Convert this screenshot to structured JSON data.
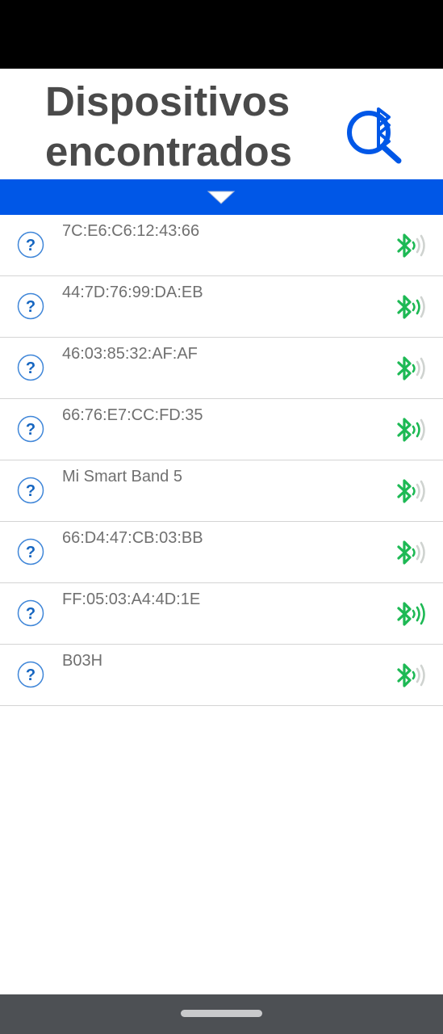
{
  "header": {
    "title": "Dispositivos\nencontrados",
    "scan_icon": "bluetooth-search-icon"
  },
  "collapse_bar": {
    "icon": "chevron-down-icon"
  },
  "devices": [
    {
      "name": "7C:E6:C6:12:43:66",
      "type_icon": "question-icon",
      "signal_icon": "bluetooth-signal-icon",
      "signal_level": 1
    },
    {
      "name": "44:7D:76:99:DA:EB",
      "type_icon": "question-icon",
      "signal_icon": "bluetooth-signal-icon",
      "signal_level": 2
    },
    {
      "name": "46:03:85:32:AF:AF",
      "type_icon": "question-icon",
      "signal_icon": "bluetooth-signal-icon",
      "signal_level": 1
    },
    {
      "name": "66:76:E7:CC:FD:35",
      "type_icon": "question-icon",
      "signal_icon": "bluetooth-signal-icon",
      "signal_level": 2
    },
    {
      "name": "Mi Smart Band 5",
      "type_icon": "question-icon",
      "signal_icon": "bluetooth-signal-icon",
      "signal_level": 1
    },
    {
      "name": "66:D4:47:CB:03:BB",
      "type_icon": "question-icon",
      "signal_icon": "bluetooth-signal-icon",
      "signal_level": 1
    },
    {
      "name": "FF:05:03:A4:4D:1E",
      "type_icon": "question-icon",
      "signal_icon": "bluetooth-signal-icon",
      "signal_level": 3
    },
    {
      "name": "B03H",
      "type_icon": "question-icon",
      "signal_icon": "bluetooth-signal-icon",
      "signal_level": 1
    }
  ],
  "colors": {
    "accent": "#0057e7",
    "signal_active": "#1db954",
    "signal_inactive": "#cfd3d0",
    "title": "#4a4a4a",
    "device_text": "#707070",
    "nav_bar": "#4d5054"
  }
}
